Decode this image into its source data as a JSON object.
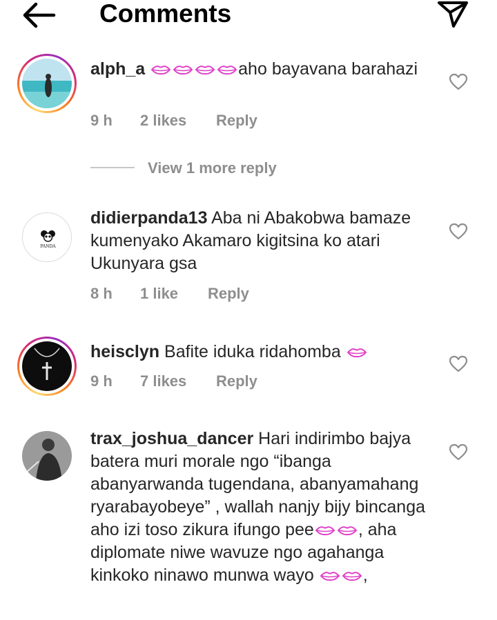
{
  "header": {
    "title": "Comments"
  },
  "comments": [
    {
      "username": "alph_a",
      "text": "aho bayavana barahazi",
      "time": "9 h",
      "likes": "2 likes",
      "reply": "Reply"
    },
    {
      "username": "didierpanda13",
      "text": "Aba ni Abakobwa bamaze kumenyako Akamaro kigitsina ko atari Ukunyara gsa",
      "time": "8 h",
      "likes": "1 like",
      "reply": "Reply",
      "avatar_text": "PANDA"
    },
    {
      "username": "heisclyn",
      "text": "Bafite iduka ridahomba",
      "time": "9 h",
      "likes": "7 likes",
      "reply": "Reply"
    },
    {
      "username": "trax_joshua_dancer",
      "text_part1": "Hari indirimbo bajya batera muri morale ngo “ibanga abanyarwanda tugendana, abanyamahang ryarabayobeye” , wallah nanjy bijy bincanga aho izi toso zikura ifungo pee",
      "text_part2": ", aha diplomate niwe wavuze ngo agahanga kinkoko ninawo munwa wayo",
      "text_part3": ","
    }
  ],
  "view_more_reply": "View 1 more reply",
  "colors": {
    "text": "#262626",
    "meta": "#8e8e8e",
    "emoji": "#e040c8"
  },
  "icons": [
    "back-arrow-icon",
    "send-icon",
    "heart-icon",
    "lips-emoji-icon"
  ]
}
